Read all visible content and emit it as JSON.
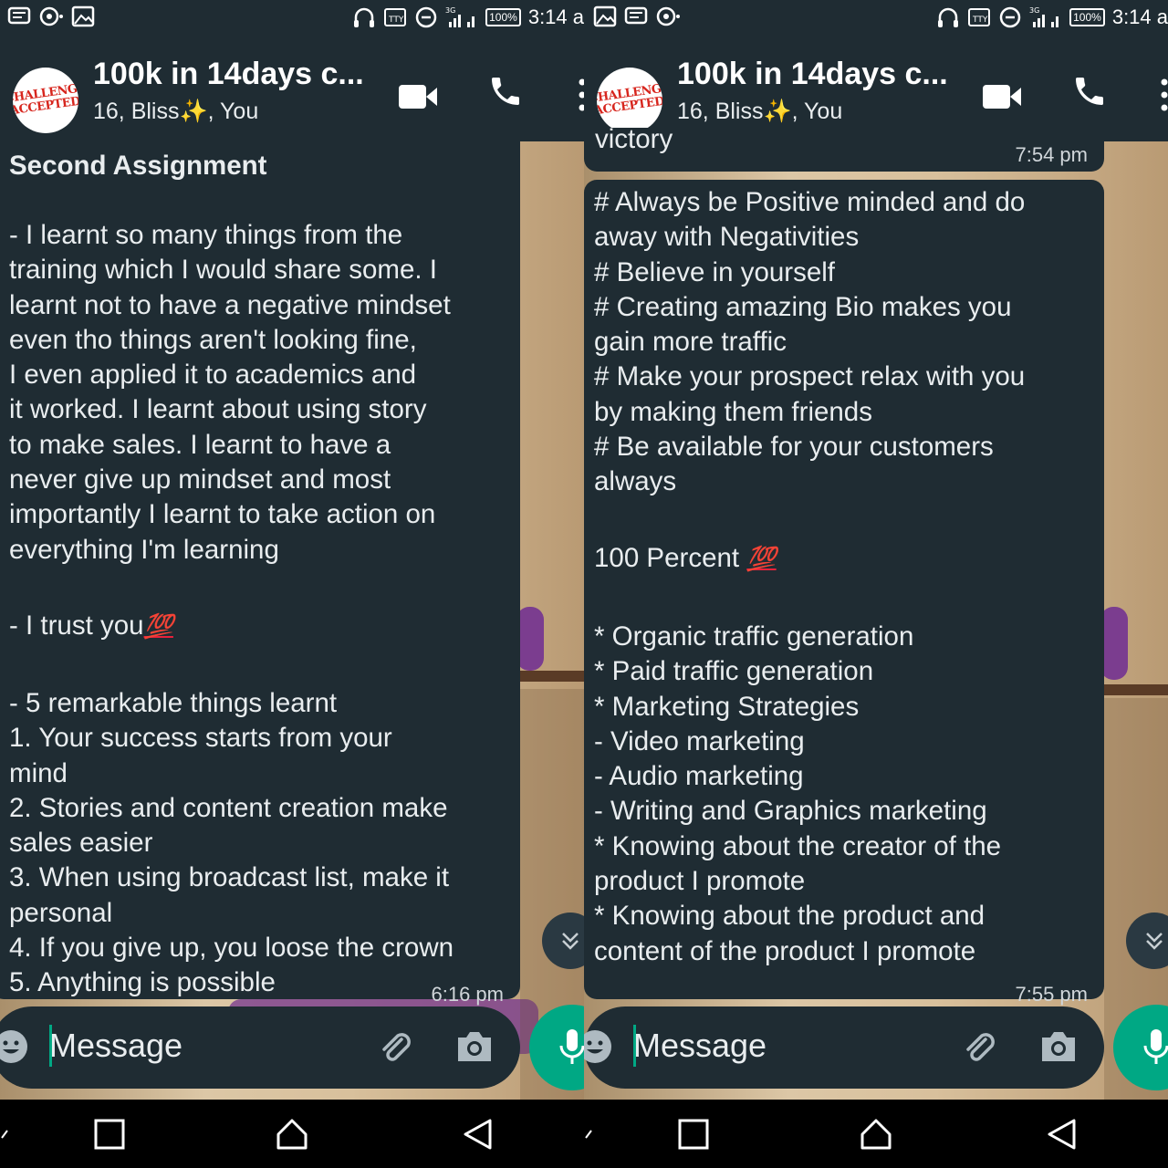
{
  "status_bar": {
    "time": "3:14 a",
    "battery": "100%",
    "network": "3G"
  },
  "chat": {
    "title": "100k in 14days c...",
    "members": "16, Bliss✨, You",
    "avatar_text": [
      "CHALLENGE",
      "ACCEPTED"
    ]
  },
  "left_message": {
    "heading": "Second Assignment",
    "para1": "- I learnt so many things from the\ntraining which I would share some. I\nlearnt not to have a negative mindset\neven tho things aren't looking fine,\nI even applied it to academics and\nit worked. I learnt about using story\nto make sales. I learnt to have a\nnever give up mindset and most\nimportantly I learnt to take action on\neverything I'm learning",
    "trust": "- I trust you",
    "emoji": "💯",
    "list": "- 5 remarkable things learnt\n1. Your success starts from your\nmind\n2. Stories and content creation make\nsales easier\n3. When using broadcast list, make it\npersonal\n4. If you give up, you loose the crown\n5. Anything is possible",
    "time": "6:16 pm"
  },
  "right_prev_message": {
    "partial_text": "victory",
    "time": "7:54 pm"
  },
  "right_message": {
    "tips": "# Always be Positive minded and do\naway with Negativities\n# Believe in yourself\n# Creating amazing Bio makes you\ngain more traffic\n# Make your prospect relax with you\nby making them friends\n# Be available for your customers\nalways",
    "percent": "100 Percent",
    "emoji": "💯",
    "list": "* Organic traffic generation\n* Paid traffic generation\n* Marketing Strategies\n- Video marketing\n- Audio marketing\n- Writing and Graphics marketing\n* Knowing about the creator of the\nproduct I promote\n* Knowing about the product and\ncontent of the product I promote",
    "time": "7:55 pm"
  },
  "input": {
    "placeholder": "Message"
  },
  "colors": {
    "panel": "#1f2c33",
    "accent": "#00a884",
    "text": "#e9edef",
    "emoji_red": "#e8213b"
  },
  "icons": [
    "video-call-icon",
    "voice-call-icon",
    "emoji-icon",
    "attach-icon",
    "camera-icon",
    "mic-icon",
    "chevron-double-down-icon",
    "recents-icon",
    "home-icon",
    "back-icon"
  ]
}
